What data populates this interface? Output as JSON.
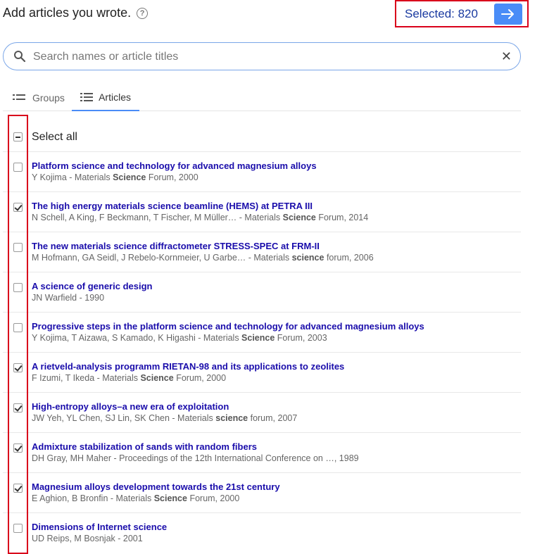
{
  "header": {
    "title": "Add articles you wrote.",
    "help_icon": "help-circle-icon",
    "selected_label": "Selected: 820",
    "next_icon": "arrow-right-icon",
    "accent_color": "#4a8cf7"
  },
  "search": {
    "placeholder": "Search names or article titles",
    "value": "",
    "clear_icon": "close-icon"
  },
  "tabs": [
    {
      "label": "Groups",
      "icon": "list-icon",
      "active": false
    },
    {
      "label": "Articles",
      "icon": "list-icon",
      "active": true
    }
  ],
  "select_all": {
    "label": "Select all",
    "state": "partial"
  },
  "articles": [
    {
      "title": "Platform science and technology for advanced magnesium alloys",
      "authors": "Y Kojima - Materials ",
      "venue_bold": "Science",
      "venue_rest": " Forum, 2000",
      "checked": false
    },
    {
      "title": "The high energy materials science beamline (HEMS) at PETRA III",
      "authors": "N Schell, A King, F Beckmann, T Fischer, M Müller… - Materials ",
      "venue_bold": "Science",
      "venue_rest": " Forum, 2014",
      "checked": true
    },
    {
      "title": "The new materials science diffractometer STRESS-SPEC at FRM-II",
      "authors": "M Hofmann, GA Seidl, J Rebelo-Kornmeier, U Garbe… - Materials ",
      "venue_bold": "science",
      "venue_rest": " forum, 2006",
      "checked": false
    },
    {
      "title": "A science of generic design",
      "authors": "JN Warfield - 1990",
      "venue_bold": "",
      "venue_rest": "",
      "checked": false
    },
    {
      "title": "Progressive steps in the platform science and technology for advanced magnesium alloys",
      "authors": "Y Kojima, T Aizawa, S Kamado, K Higashi - Materials ",
      "venue_bold": "Science",
      "venue_rest": " Forum, 2003",
      "checked": false
    },
    {
      "title": "A rietveld-analysis programm RIETAN-98 and its applications to zeolites",
      "authors": "F Izumi, T Ikeda - Materials ",
      "venue_bold": "Science",
      "venue_rest": " Forum, 2000",
      "checked": true
    },
    {
      "title": "High-entropy alloys–a new era of exploitation",
      "authors": "JW Yeh, YL Chen, SJ Lin, SK Chen - Materials ",
      "venue_bold": "science",
      "venue_rest": " forum, 2007",
      "checked": true
    },
    {
      "title": "Admixture stabilization of sands with random fibers",
      "authors": "DH Gray, MH Maher - Proceedings of the 12th International Conference on …, 1989",
      "venue_bold": "",
      "venue_rest": "",
      "checked": true
    },
    {
      "title": "Magnesium alloys development towards the 21st century",
      "authors": "E Aghion, B Bronfin - Materials ",
      "venue_bold": "Science",
      "venue_rest": " Forum, 2000",
      "checked": true
    },
    {
      "title": "Dimensions of Internet science",
      "authors": "UD Reips, M Bosnjak - 2001",
      "venue_bold": "",
      "venue_rest": "",
      "checked": false
    }
  ]
}
